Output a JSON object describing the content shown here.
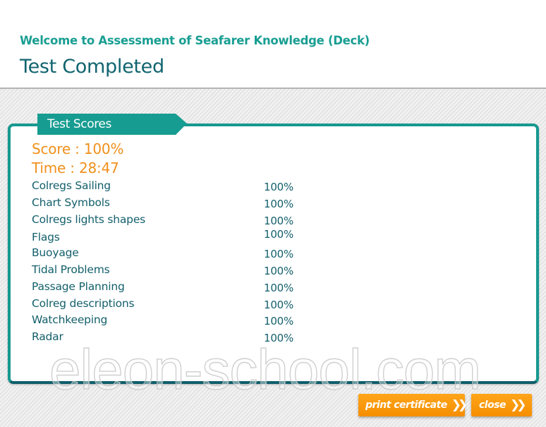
{
  "header": {
    "subtitle": "Welcome to Assessment of Seafarer Knowledge (Deck)",
    "title": "Test Completed"
  },
  "panel": {
    "tab_label": "Test Scores",
    "score_text": "Score : 100%",
    "time_text": "Time : 28:47",
    "rows": [
      {
        "label": "Colregs Sailing",
        "value": "100%"
      },
      {
        "label": "Chart Symbols",
        "value": "100%"
      },
      {
        "label": "Colregs lights shapes",
        "value": "100%"
      },
      {
        "label": "Flags",
        "value": "100%"
      },
      {
        "label": "Buoyage",
        "value": "100%"
      },
      {
        "label": "Tidal Problems",
        "value": "100%"
      },
      {
        "label": "Passage Planning",
        "value": "100%"
      },
      {
        "label": "Colreg descriptions",
        "value": "100%"
      },
      {
        "label": "Watchkeeping",
        "value": "100%"
      },
      {
        "label": "Radar",
        "value": "100%"
      }
    ]
  },
  "watermark": "eleon-school.com",
  "buttons": {
    "print_label": "print certificate",
    "close_label": "close",
    "chevron_glyph": "❯❯"
  },
  "colors": {
    "teal_accent": "#17998f",
    "dark_teal": "#11646f",
    "orange": "#f0901c",
    "button_orange": "#f79a0c"
  }
}
